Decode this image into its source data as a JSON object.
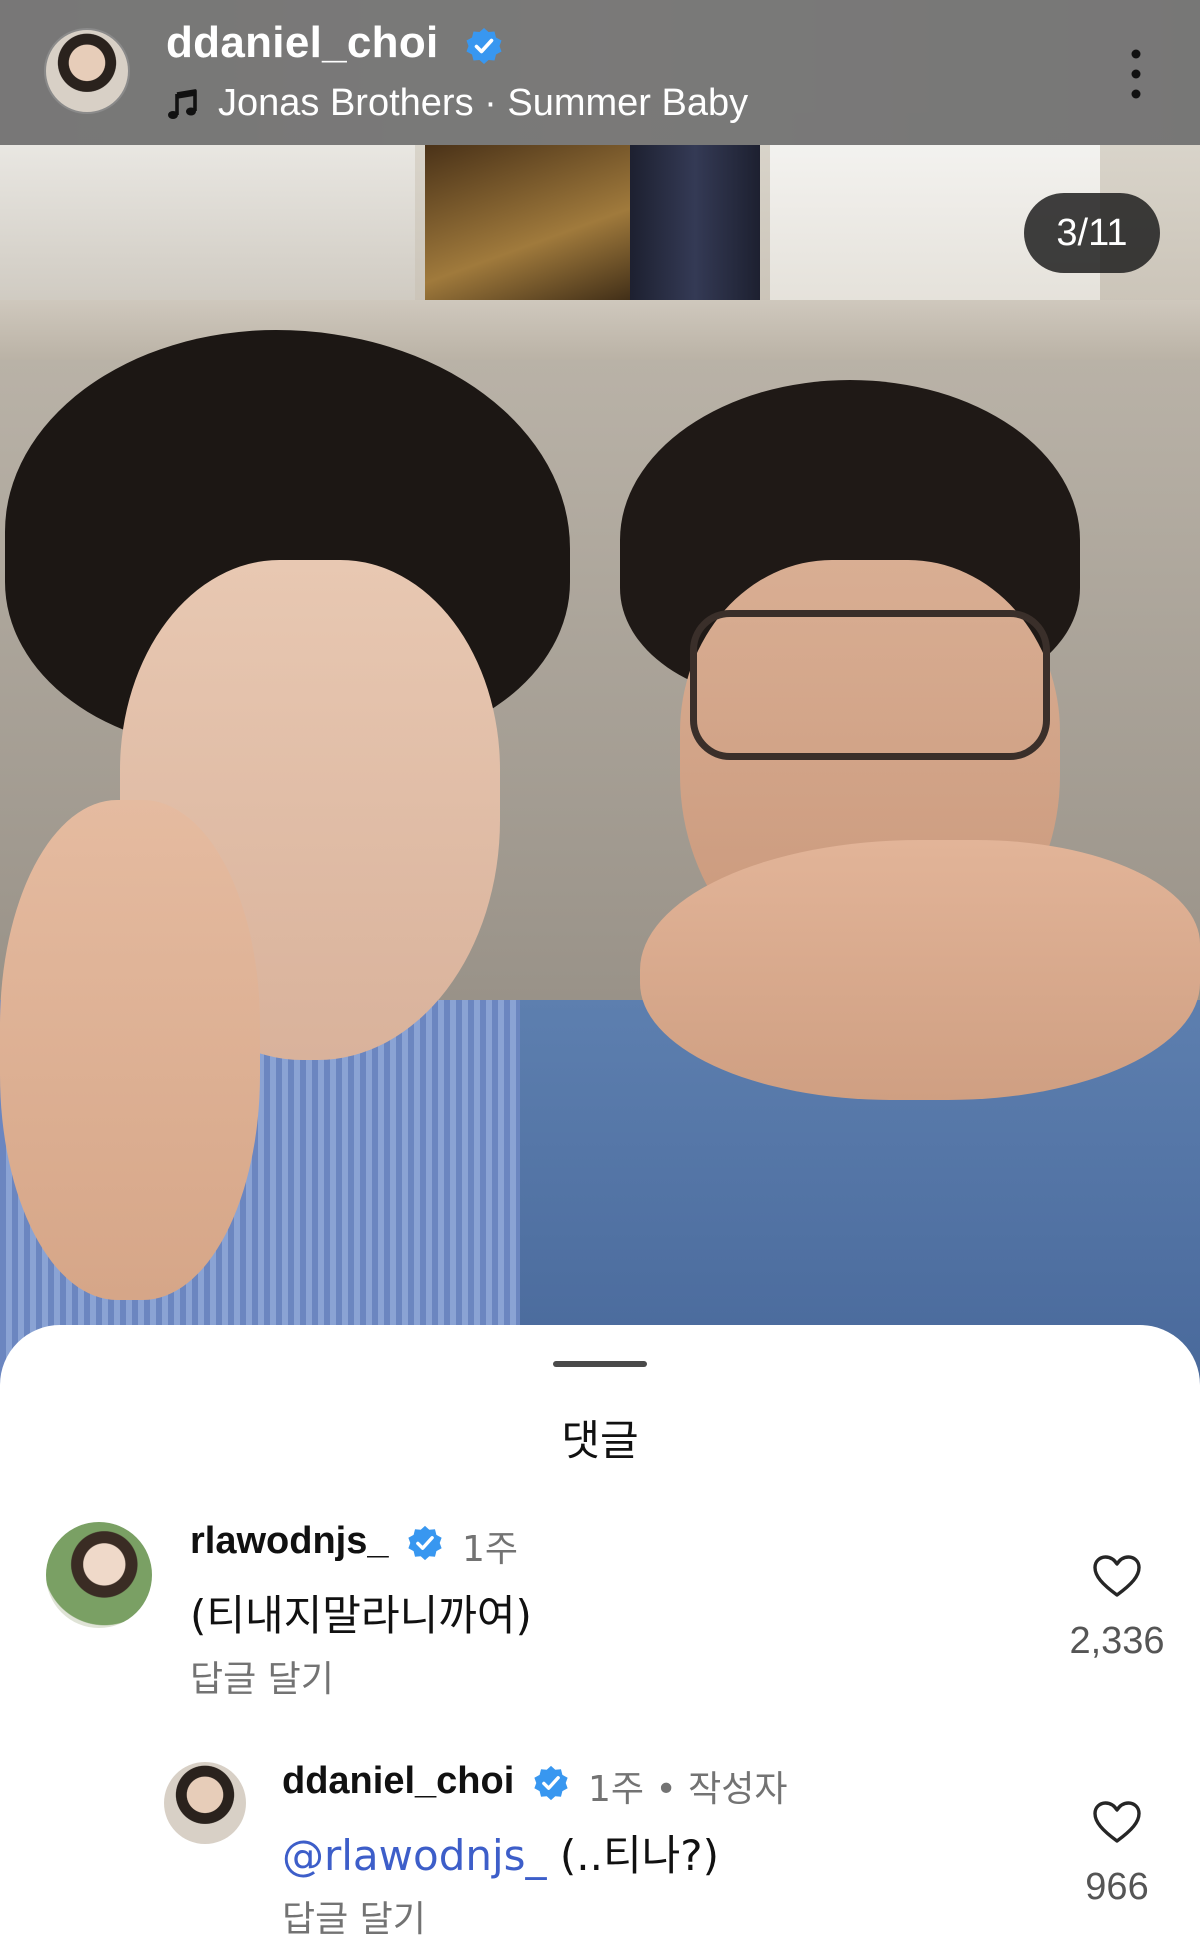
{
  "header": {
    "username": "ddaniel_choi",
    "song": "Jonas Brothers · Summer Baby"
  },
  "media": {
    "counter": "3/11"
  },
  "comments_sheet": {
    "title": "댓글",
    "comments": [
      {
        "username": "rlawodnjs_",
        "time": "1주",
        "text": "(티내지말라니까여)",
        "reply_label": "답글 달기",
        "likes": "2,336"
      },
      {
        "username": "ddaniel_choi",
        "time": "1주 • 작성자",
        "mention": "@rlawodnjs_",
        "text": " (..티나?)",
        "reply_label": "답글 달기",
        "likes": "966"
      }
    ]
  },
  "colors": {
    "verified_badge": "#3897f0",
    "mention": "#3d5ec9",
    "secondary_text": "#737373"
  },
  "icons": [
    "music-note-icon",
    "verified-badge-icon",
    "more-options-icon",
    "heart-icon"
  ]
}
